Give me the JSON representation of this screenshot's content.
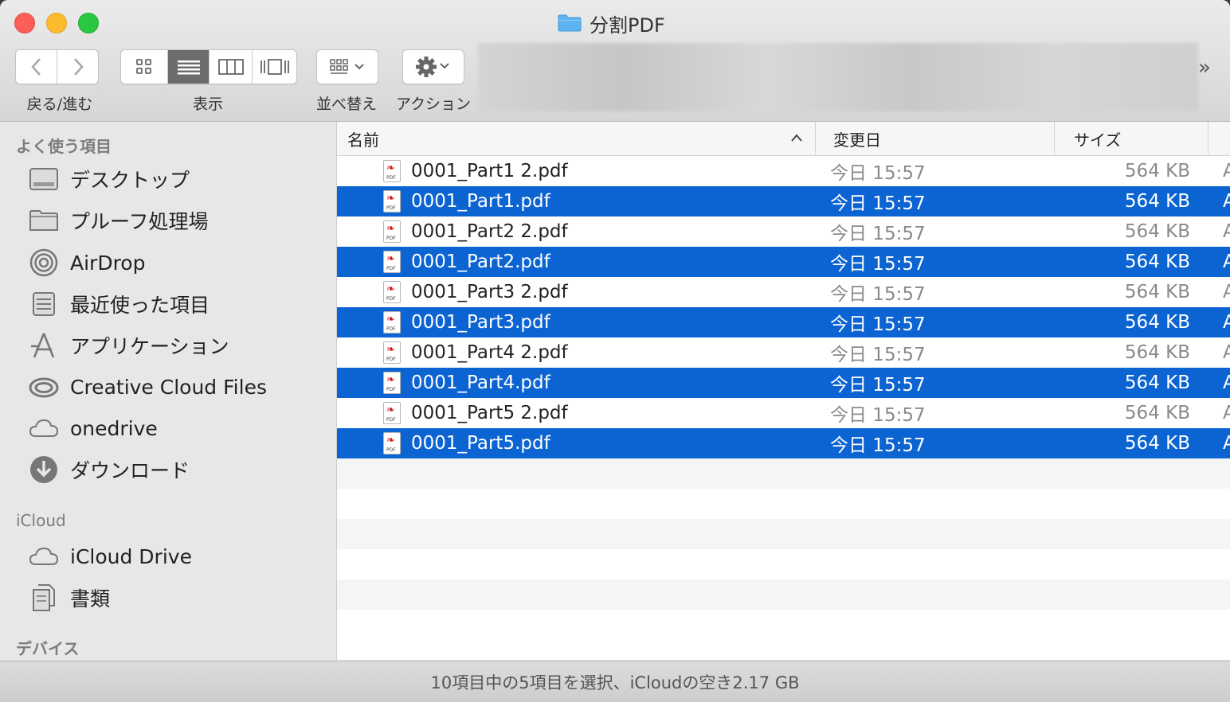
{
  "window": {
    "title": "分割PDF"
  },
  "toolbar": {
    "nav_label": "戻る/進む",
    "view_label": "表示",
    "sort_label": "並べ替え",
    "action_label": "アクション",
    "overflow": "»"
  },
  "sidebar": {
    "favorites_header": "よく使う項目",
    "favorites": [
      {
        "label": "デスクトップ",
        "icon": "desktop-icon"
      },
      {
        "label": "プルーフ処理場",
        "icon": "folder-icon"
      },
      {
        "label": "AirDrop",
        "icon": "airdrop-icon"
      },
      {
        "label": "最近使った項目",
        "icon": "recents-icon"
      },
      {
        "label": "アプリケーション",
        "icon": "applications-icon"
      },
      {
        "label": "Creative Cloud Files",
        "icon": "creative-cloud-icon"
      },
      {
        "label": "onedrive",
        "icon": "cloud-icon"
      },
      {
        "label": "ダウンロード",
        "icon": "download-icon"
      }
    ],
    "icloud_header": "iCloud",
    "icloud": [
      {
        "label": "iCloud Drive",
        "icon": "icloud-icon"
      },
      {
        "label": "書類",
        "icon": "documents-icon"
      }
    ],
    "devices_header": "デバイス"
  },
  "columns": {
    "name": "名前",
    "date": "変更日",
    "size": "サイズ",
    "sort_indicator": "^"
  },
  "files": [
    {
      "name": "0001_Part1 2.pdf",
      "date": "今日 15:57",
      "size": "564 KB",
      "kind": "A",
      "selected": false
    },
    {
      "name": "0001_Part1.pdf",
      "date": "今日 15:57",
      "size": "564 KB",
      "kind": "A",
      "selected": true
    },
    {
      "name": "0001_Part2 2.pdf",
      "date": "今日 15:57",
      "size": "564 KB",
      "kind": "A",
      "selected": false
    },
    {
      "name": "0001_Part2.pdf",
      "date": "今日 15:57",
      "size": "564 KB",
      "kind": "A",
      "selected": true
    },
    {
      "name": "0001_Part3 2.pdf",
      "date": "今日 15:57",
      "size": "564 KB",
      "kind": "A",
      "selected": false
    },
    {
      "name": "0001_Part3.pdf",
      "date": "今日 15:57",
      "size": "564 KB",
      "kind": "A",
      "selected": true
    },
    {
      "name": "0001_Part4 2.pdf",
      "date": "今日 15:57",
      "size": "564 KB",
      "kind": "A",
      "selected": false
    },
    {
      "name": "0001_Part4.pdf",
      "date": "今日 15:57",
      "size": "564 KB",
      "kind": "A",
      "selected": true
    },
    {
      "name": "0001_Part5 2.pdf",
      "date": "今日 15:57",
      "size": "564 KB",
      "kind": "A",
      "selected": false
    },
    {
      "name": "0001_Part5.pdf",
      "date": "今日 15:57",
      "size": "564 KB",
      "kind": "A",
      "selected": true
    }
  ],
  "status": {
    "text": "10項目中の5項目を選択、iCloudの空き2.17 GB"
  },
  "colors": {
    "selection": "#0c64d3",
    "close": "#fc5f57",
    "minimize": "#fdbc2e",
    "zoom": "#29c840",
    "folder": "#5eb4f2"
  }
}
